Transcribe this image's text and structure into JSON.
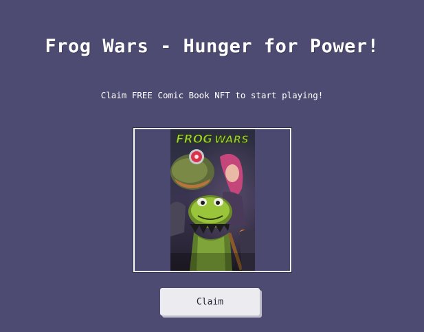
{
  "header": {
    "title": "Frog Wars - Hunger for Power!",
    "subtitle": "Claim FREE Comic Book NFT to start playing!"
  },
  "nft_card": {
    "cover_logo_line1": "FROG",
    "cover_logo_line2": "WARS"
  },
  "actions": {
    "claim_label": "Claim"
  },
  "colors": {
    "background": "#4e4b72",
    "frame_border": "#ffffff",
    "button_bg": "#ececf0",
    "logo_green": "#9ed13a"
  }
}
